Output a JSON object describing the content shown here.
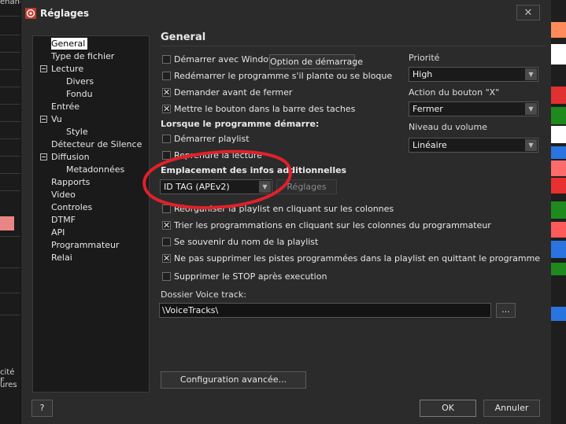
{
  "background": {
    "left_texts": [
      "enane",
      "cité F",
      "ures"
    ],
    "right_colors": [
      "#1e1e1e",
      "#ff8a5a",
      "#ffffff",
      "#1e1e1e",
      "#e03030",
      "#1e8a1e",
      "#ffffff",
      "#2a74e0",
      "#ff6b6b",
      "#e83030",
      "#1e8a1e",
      "#ff5a5a",
      "#2a74e0",
      "#1e8a1e",
      "#2a74e0"
    ]
  },
  "dialog": {
    "title": "Réglages",
    "close_label": "✕"
  },
  "tree": {
    "items": [
      {
        "label": "General",
        "selected": true
      },
      {
        "label": "Type de fichier"
      },
      {
        "label": "Lecture",
        "expandable": true
      },
      {
        "label": "Divers"
      },
      {
        "label": "Fondu"
      },
      {
        "label": "Entrée"
      },
      {
        "label": "Vu",
        "expandable": true
      },
      {
        "label": "Style"
      },
      {
        "label": "Détecteur de Silence"
      },
      {
        "label": "Diffusion",
        "expandable": true
      },
      {
        "label": "Metadonnées"
      },
      {
        "label": "Rapports"
      },
      {
        "label": "Video"
      },
      {
        "label": "Controles"
      },
      {
        "label": "DTMF"
      },
      {
        "label": "API"
      },
      {
        "label": "Programmateur"
      },
      {
        "label": "Relai"
      }
    ]
  },
  "general": {
    "section_title": "General",
    "start_with_windows": {
      "label": "Démarrer avec Windows",
      "checked": false
    },
    "start_options_button": "Option de démarrage",
    "restart_on_crash": {
      "label": "Redémarrer le programme s'il plante ou se bloque",
      "checked": false
    },
    "ask_before_close": {
      "label": "Demander avant de fermer",
      "checked": true
    },
    "taskbar_button": {
      "label": "Mettre le bouton dans la barre des taches",
      "checked": true
    },
    "on_start_title": "Lorsque le programme démarre:",
    "start_playlist": {
      "label": "Démarrer playlist",
      "checked": false
    },
    "resume_playback": {
      "label": "Reprendre la lecture",
      "checked": false
    },
    "extra_info_title": "Emplacement des infos additionnelles",
    "extra_info_select": "ID TAG (APEv2)",
    "extra_info_settings_button": "Réglages",
    "reorganize_playlist": {
      "label": "Réorganiser la playlist en cliquant sur les colonnes",
      "checked": false
    },
    "sort_programs": {
      "label": "Trier les programmations en cliquant sur les colonnes du programmateur",
      "checked": true
    },
    "remember_playlist": {
      "label": "Se souvenir du nom de la playlist",
      "checked": false
    },
    "keep_programmed": {
      "label": "Ne pas supprimer les pistes programmées dans la playlist en quittant le programme",
      "checked": true
    },
    "remove_stop": {
      "label": "Supprimer le STOP après execution",
      "checked": false
    },
    "voice_track_label": "Dossier Voice track:",
    "voice_track_value": "\\VoiceTracks\\",
    "browse_button": "...",
    "advanced_button": "Configuration avancée...",
    "priority_label": "Priorité",
    "priority_value": "High",
    "x_action_label": "Action du bouton \"X\"",
    "x_action_value": "Fermer",
    "volume_label": "Niveau du volume",
    "volume_value": "Linéaire"
  },
  "footer": {
    "help_button": "?",
    "ok_button": "OK",
    "cancel_button": "Annuler"
  },
  "annotation_color": "#e0202a"
}
